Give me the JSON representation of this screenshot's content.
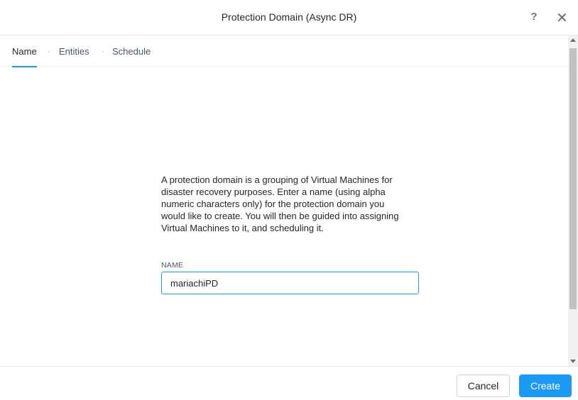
{
  "dialog": {
    "title": "Protection Domain (Async DR)",
    "help_label": "?"
  },
  "tabs": [
    {
      "label": "Name",
      "active": true
    },
    {
      "label": "Entities",
      "active": false
    },
    {
      "label": "Schedule",
      "active": false
    }
  ],
  "main": {
    "description": "A protection domain is a grouping of Virtual Machines for disaster recovery purposes. Enter a name (using alpha numeric characters only) for the protection domain you would like to create. You will then be guided into assigning Virtual Machines to it, and scheduling it.",
    "name_label": "NAME",
    "name_value": "mariachiPD"
  },
  "footer": {
    "cancel_label": "Cancel",
    "create_label": "Create"
  },
  "colors": {
    "accent": "#1b9af5",
    "text": "#22272e"
  },
  "icons": {
    "help": "help-icon",
    "close": "close-icon"
  }
}
